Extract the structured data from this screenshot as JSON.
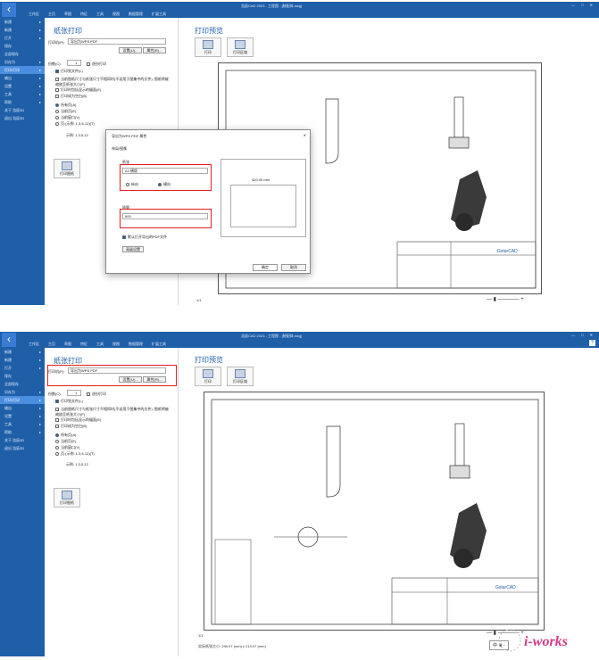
{
  "top": {
    "titlebar": {
      "tabs": [
        "工作区",
        "主页",
        "草图",
        "特征",
        "工具",
        "视图",
        "数据管理",
        "扩展工具"
      ],
      "title": "浩辰CAD 2023 - 工程图 - [装配体.dwg]",
      "win_controls": "— □ ✕"
    },
    "sidebar": [
      "新建",
      "新建",
      "打开",
      "保存",
      "全部保存",
      "另存为",
      "打印/打印",
      "输出",
      "设置",
      "工具",
      "帮助",
      "关于 浩辰3D",
      "退出 浩辰3D"
    ],
    "sidebar_arrows": "▸",
    "panel": {
      "title": "纸张打印",
      "printer_label": "打印机(P):",
      "printer_value": "导出为WPS PDF",
      "settings_button": "设置(U)...",
      "properties_button": "属性(R)...",
      "copies_label": "份数(C):",
      "copies_value": "1",
      "collate_label": "逐份打印",
      "options": [
        "打印到文件(L)",
        "当前图纸尺寸与纸张尺寸不相同时(不适用于图集中的文件), 图纸将被缩放至纸张大小(F)",
        "打印时包括显示的幅面(E)",
        "打印成为空白(B)"
      ],
      "range_options": [
        "所有页(A)",
        "当前页(E)",
        "当前窗口(V)",
        "页:(示例: 1,3,5-12)(T)"
      ],
      "pages_hint": "示例: 1,3,5-12",
      "batch_button": "打印图纸"
    },
    "preview": {
      "title": "打印预览",
      "print_button": "打印",
      "print_area_button": "打印区域",
      "page_indicator": "1/1"
    },
    "dialog": {
      "title": "导出为WPS PDF 属性",
      "tab": "布局/图像",
      "group_paper": "纸张",
      "paper_value": "A3 横版",
      "orient_portrait": "纵向",
      "orient_landscape": "横向",
      "group_quality": "质量",
      "quality_value": "600",
      "embed_fonts": "默认打开导出的PDF文件",
      "advanced_button": "高级设置",
      "ok_button": "确定",
      "cancel_button": "取消",
      "dim_width": "420.00 mm",
      "dim_height": "297.00 mm"
    }
  },
  "bottom": {
    "titlebar": {
      "tabs": [
        "工作区",
        "主页",
        "草图",
        "特征",
        "工具",
        "视图",
        "数据管理",
        "扩展工具"
      ],
      "title": "浩辰CAD 2023 - 工程图 - [装配体.dwg]",
      "win_controls": "— □ ✕",
      "help": "?"
    },
    "panel": {
      "title": "纸张打印",
      "printer_label": "打印机(P):",
      "printer_value": "导出为WPS PDF",
      "settings_button": "设置(U)...",
      "properties_button": "属性(R)...",
      "copies_label": "份数(C):",
      "copies_value": "1",
      "collate_label": "逐份打印",
      "pages_hint": "示例: 1,3,5-12",
      "batch_button": "打印图纸"
    },
    "preview": {
      "title": "打印预览",
      "print_button": "打印",
      "print_area_button": "打印区域",
      "page_indicator": "1/1",
      "actual_size": "实际纸张大小:  296.97 (mm) x 219.97 (mm)"
    },
    "logo_text": "GstarCAD",
    "watermark": "i-works",
    "ime": "中 ♛ ·"
  }
}
